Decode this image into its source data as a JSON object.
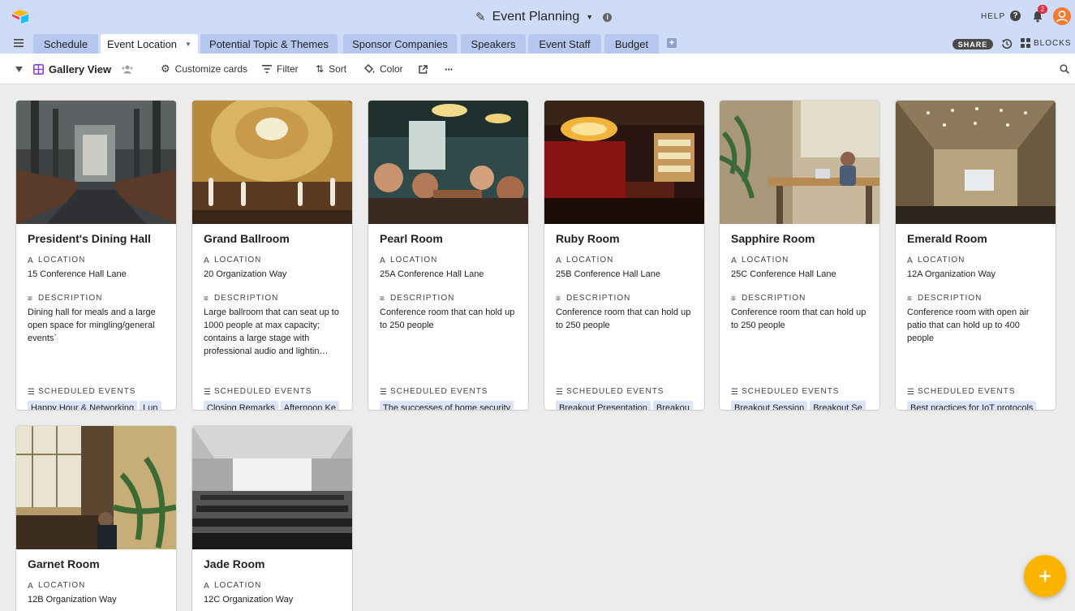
{
  "header": {
    "title": "Event Planning",
    "help_label": "HELP",
    "notification_count": "2"
  },
  "tabs": [
    {
      "label": "Schedule"
    },
    {
      "label": "Event Location"
    },
    {
      "label": "Potential Topic & Themes"
    },
    {
      "label": "Sponsor Companies"
    },
    {
      "label": "Speakers"
    },
    {
      "label": "Event Staff"
    },
    {
      "label": "Budget"
    }
  ],
  "tabbar": {
    "share_label": "SHARE",
    "blocks_label": "BLOCKS"
  },
  "toolbar": {
    "view_name": "Gallery View",
    "customize_label": "Customize cards",
    "filter_label": "Filter",
    "sort_label": "Sort",
    "color_label": "Color"
  },
  "fields": {
    "location": "LOCATION",
    "description": "DESCRIPTION",
    "scheduled_events": "SCHEDULED EVENTS"
  },
  "cards": [
    {
      "name": "President's Dining Hall",
      "location": "15 Conference Hall Lane",
      "description": "Dining hall for meals and a large open space for mingling/general events`",
      "events": [
        "Happy Hour & Networking",
        "Lun"
      ]
    },
    {
      "name": "Grand Ballroom",
      "location": "20 Organization Way",
      "description": "Large ballroom that can seat up to 1000 people at max capacity; contains a large stage with professional audio and lightin…",
      "events": [
        "Closing Remarks",
        "Afternoon Ke"
      ]
    },
    {
      "name": "Pearl Room",
      "location": "25A Conference Hall Lane",
      "description": "Conference room that can hold up to 250 people",
      "events": [
        "The successes of home security"
      ]
    },
    {
      "name": "Ruby Room",
      "location": "25B Conference Hall Lane",
      "description": "Conference room that can hold up to 250 people",
      "events": [
        "Breakout Presentation",
        "Breakou"
      ]
    },
    {
      "name": "Sapphire Room",
      "location": "25C Conference Hall Lane",
      "description": "Conference room that can hold up to 250 people",
      "events": [
        "Breakout Session",
        "Breakout Se"
      ]
    },
    {
      "name": "Emerald Room",
      "location": "12A Organization Way",
      "description": "Conference room with open air patio that can hold up to 400 people",
      "events": [
        "Best practices for IoT protocols"
      ]
    },
    {
      "name": "Garnet Room",
      "location": "12B Organization Way",
      "description": "",
      "events": []
    },
    {
      "name": "Jade Room",
      "location": "12C Organization Way",
      "description": "",
      "events": []
    }
  ],
  "colors": {
    "header_bg": "#cfdcf8",
    "tab_inactive": "#b5c7ee",
    "chip_bg": "#dbe5f7",
    "fab": "#fcb400",
    "badge": "#e02e45",
    "avatar": "#f27a33"
  },
  "icons": [
    "airtable-logo-icon",
    "pencil-icon",
    "info-icon",
    "help-icon",
    "bell-icon",
    "avatar",
    "hamburger-icon",
    "share-button",
    "history-icon",
    "blocks-icon",
    "gallery-view-icon",
    "collaborators-icon",
    "gear-icon",
    "filter-icon",
    "sort-icon",
    "color-bucket-icon",
    "share-view-icon",
    "more-icon",
    "search-icon",
    "add-icon"
  ]
}
